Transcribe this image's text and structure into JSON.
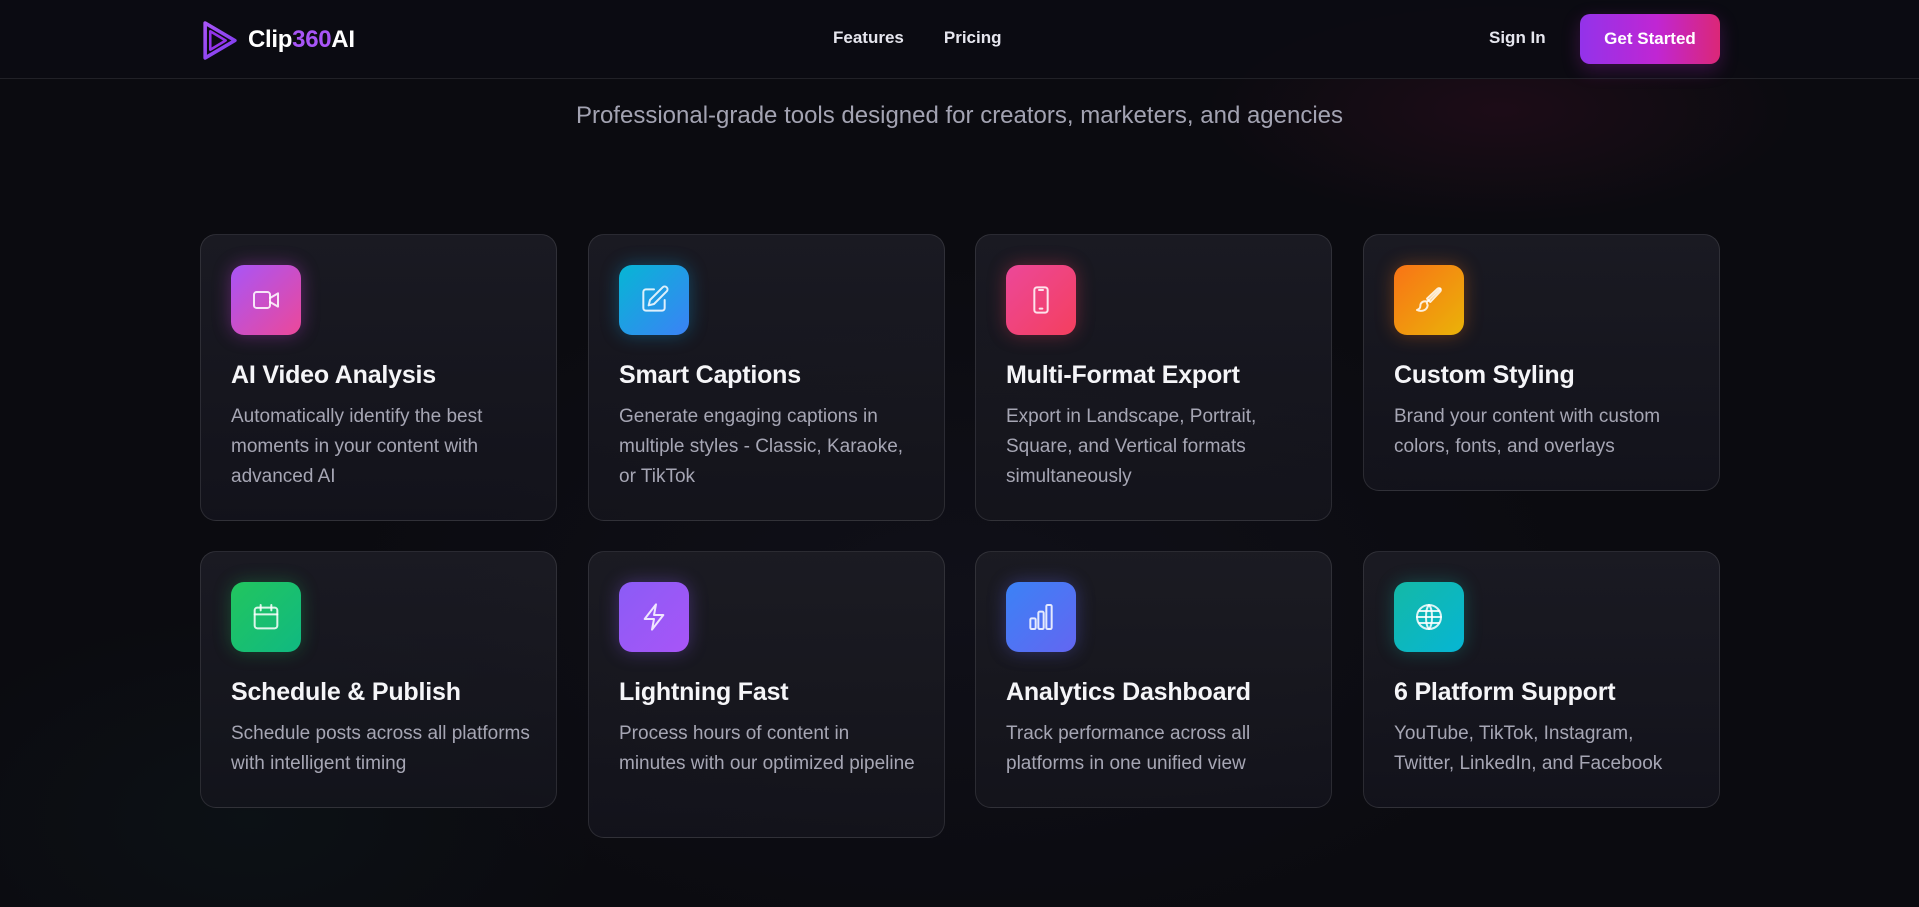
{
  "brand": {
    "name_part1": "Clip",
    "name_accent": "360",
    "name_part2": "AI",
    "logo_icon": "play-triangle-icon",
    "accent_color": "#a855f7"
  },
  "nav": {
    "features": "Features",
    "pricing": "Pricing"
  },
  "auth": {
    "sign_in": "Sign In",
    "get_started": "Get Started"
  },
  "hero": {
    "subtitle": "Professional-grade tools designed for creators, marketers, and agencies"
  },
  "features": [
    {
      "title": "AI Video Analysis",
      "description": "Automatically identify the best moments in your content with advanced AI",
      "icon": "video-camera-icon",
      "color": "#c94ee0"
    },
    {
      "title": "Smart Captions",
      "description": "Generate engaging captions in multiple styles - Classic, Karaoke, or TikTok",
      "icon": "pen-edit-icon",
      "color": "#1ea5e9"
    },
    {
      "title": "Multi-Format Export",
      "description": "Export in Landscape, Portrait, Square, and Vertical formats simultaneously",
      "icon": "smartphone-icon",
      "color": "#f43f6b"
    },
    {
      "title": "Custom Styling",
      "description": "Brand your content with custom colors, fonts, and overlays",
      "icon": "paintbrush-icon",
      "color": "#f59e0b"
    },
    {
      "title": "Schedule & Publish",
      "description": "Schedule posts across all platforms with intelligent timing",
      "icon": "calendar-icon",
      "color": "#22c55e"
    },
    {
      "title": "Lightning Fast",
      "description": "Process hours of content in minutes with our optimized pipeline",
      "icon": "lightning-bolt-icon",
      "color": "#9b5cf6"
    },
    {
      "title": "Analytics Dashboard",
      "description": "Track performance across all platforms in one unified view",
      "icon": "bar-chart-icon",
      "color": "#4f74f0"
    },
    {
      "title": "6 Platform Support",
      "description": "YouTube, TikTok, Instagram, Twitter, LinkedIn, and Facebook",
      "icon": "globe-icon",
      "color": "#12b8c0"
    }
  ]
}
